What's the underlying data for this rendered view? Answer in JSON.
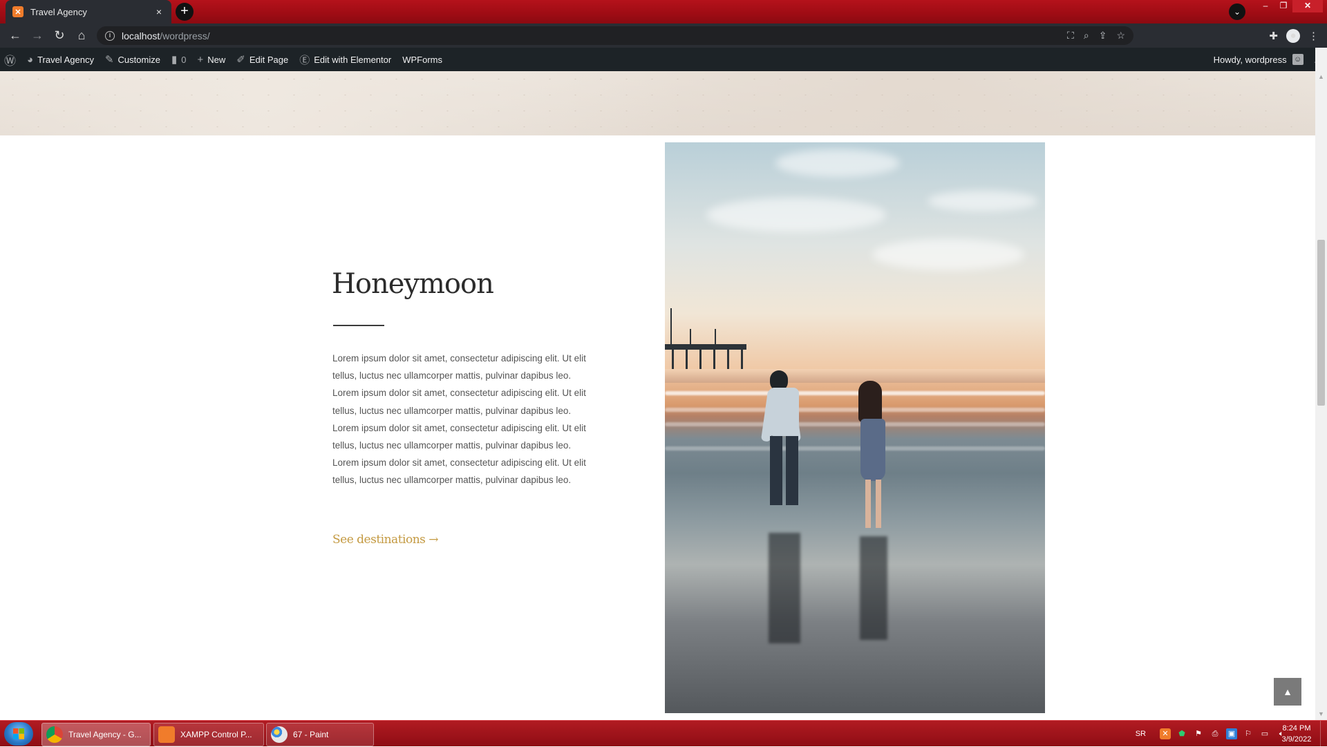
{
  "browser": {
    "tab_title": "Travel Agency",
    "tab_close": "×",
    "new_tab": "+",
    "url_host": "localhost",
    "url_path": "/wordpress/"
  },
  "adminbar": {
    "site_name": "Travel Agency",
    "customize": "Customize",
    "comments_count": "0",
    "new_label": "New",
    "edit_page": "Edit Page",
    "edit_elementor": "Edit with Elementor",
    "wpforms": "WPForms",
    "howdy": "Howdy, wordpress"
  },
  "content": {
    "heading": "Honeymoon",
    "paragraph": "Lorem ipsum dolor sit amet, consectetur adipiscing elit. Ut elit tellus, luctus nec ullamcorper mattis, pulvinar dapibus leo. Lorem ipsum dolor sit amet, consectetur adipiscing elit. Ut elit tellus, luctus nec ullamcorper mattis, pulvinar dapibus leo. Lorem ipsum dolor sit amet, consectetur adipiscing elit. Ut elit tellus, luctus nec ullamcorper mattis, pulvinar dapibus leo. Lorem ipsum dolor sit amet, consectetur adipiscing elit. Ut elit tellus, luctus nec ullamcorper mattis, pulvinar dapibus leo.",
    "cta": "See destinations →"
  },
  "taskbar": {
    "items": [
      {
        "label": "Travel Agency - G..."
      },
      {
        "label": "XAMPP Control P..."
      },
      {
        "label": "67 - Paint"
      }
    ],
    "lang": "SR",
    "time": "8:24 PM",
    "date": "3/9/2022"
  },
  "colors": {
    "accent_cta": "#c49a42",
    "adminbar_bg": "#1d2327",
    "taskbar_bg": "#9e0c14"
  }
}
